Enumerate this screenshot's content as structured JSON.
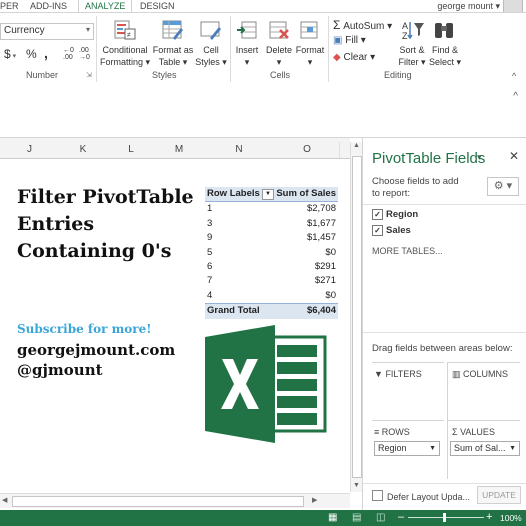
{
  "tabs": [
    "PER",
    "ADD-INS",
    "ANALYZE",
    "DESIGN"
  ],
  "user": "george mount",
  "ribbon": {
    "number_format": "Currency",
    "currency_symbol": "$",
    "percent_symbol": "%",
    "comma_symbol": ",",
    "number_group": "Number",
    "conditional_formatting": [
      "Conditional",
      "Formatting"
    ],
    "format_as_table": [
      "Format as",
      "Table"
    ],
    "cell_styles": [
      "Cell",
      "Styles"
    ],
    "styles_group": "Styles",
    "insert": "Insert",
    "delete": "Delete",
    "format": "Format",
    "cells_group": "Cells",
    "autosum": "AutoSum",
    "fill": "Fill",
    "clear": "Clear",
    "sort_filter": [
      "Sort &",
      "Filter"
    ],
    "find_select": [
      "Find &",
      "Select"
    ],
    "editing_group": "Editing"
  },
  "columns": [
    "J",
    "K",
    "L",
    "M",
    "N",
    "O"
  ],
  "sheet": {
    "title_lines": [
      "Filter PivotTable",
      "Entries",
      "Containing 0's"
    ],
    "subscribe": "Subscribe for more!",
    "site": "georgejmount.com",
    "handle": "@gjmount"
  },
  "pivot": {
    "header_rows": "Row Labels",
    "header_sales": "Sum of Sales",
    "rows": [
      {
        "label": "1",
        "value": "$2,708"
      },
      {
        "label": "3",
        "value": "$1,677"
      },
      {
        "label": "9",
        "value": "$1,457"
      },
      {
        "label": "5",
        "value": "$0"
      },
      {
        "label": "6",
        "value": "$291"
      },
      {
        "label": "7",
        "value": "$271"
      },
      {
        "label": "4",
        "value": "$0"
      }
    ],
    "total_label": "Grand Total",
    "total_value": "$6,404"
  },
  "pane": {
    "title": "PivotTable Fields",
    "choose": "Choose fields to add to report:",
    "fields": [
      "Region",
      "Sales"
    ],
    "more_tables": "MORE TABLES...",
    "drag": "Drag fields between areas below:",
    "filters": "FILTERS",
    "columns": "COLUMNS",
    "rows": "ROWS",
    "values": "VALUES",
    "rows_value": "Region",
    "values_value": "Sum of Sal...",
    "defer": "Defer Layout Upda...",
    "update": "UPDATE"
  },
  "status": {
    "zoom": "100%"
  },
  "colors": {
    "excel_green": "#217346",
    "pivot_header": "#dce6f1",
    "subscribe": "#3aa6d8"
  }
}
